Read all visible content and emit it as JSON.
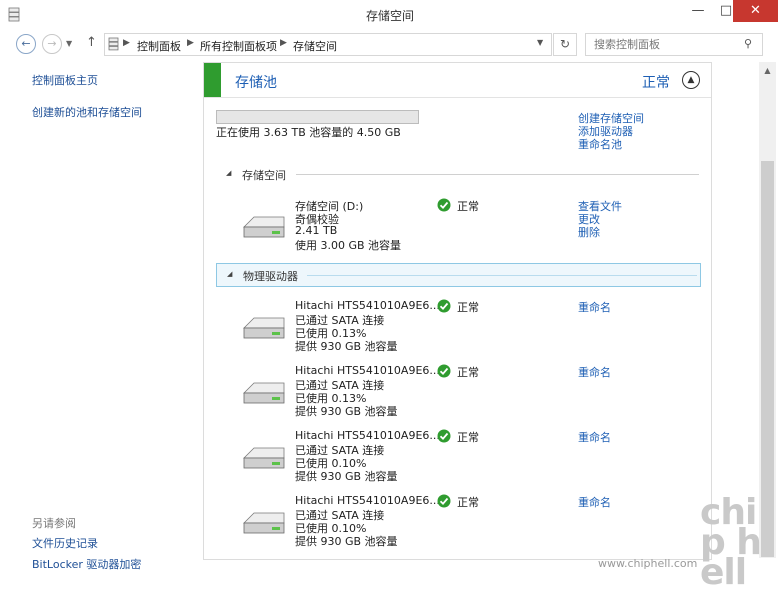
{
  "window": {
    "title": "存储空间",
    "min_label": "—",
    "max_label": "□",
    "close_label": "✕"
  },
  "address": {
    "crumbs": [
      "控制面板",
      "所有控制面板项",
      "存储空间"
    ],
    "search_placeholder": "搜索控制面板"
  },
  "sidebar": {
    "links": [
      "控制面板主页",
      "创建新的池和存储空间"
    ],
    "see_also_label": "另请参阅",
    "see_also": [
      "文件历史记录",
      "BitLocker 驱动器加密"
    ]
  },
  "pool": {
    "title": "存储池",
    "status": "正常",
    "usage_text": "正在使用 3.63 TB 池容量的 4.50 GB",
    "usage_fraction": 0.001,
    "actions": [
      "创建存储空间",
      "添加驱动器",
      "重命名池"
    ]
  },
  "spaces_section": {
    "title": "存储空间",
    "items": [
      {
        "lines": [
          "存储空间 (D:)",
          "奇偶校验",
          "2.41 TB",
          "使用 3.00 GB 池容量"
        ],
        "status": "正常",
        "actions": [
          "查看文件",
          "更改",
          "删除"
        ]
      }
    ]
  },
  "drives_section": {
    "title": "物理驱动器",
    "items": [
      {
        "lines": [
          "Hitachi HTS541010A9E6...",
          "已通过 SATA 连接",
          "已使用 0.13%",
          "提供 930 GB 池容量"
        ],
        "status": "正常",
        "action": "重命名"
      },
      {
        "lines": [
          "Hitachi HTS541010A9E6...",
          "已通过 SATA 连接",
          "已使用 0.13%",
          "提供 930 GB 池容量"
        ],
        "status": "正常",
        "action": "重命名"
      },
      {
        "lines": [
          "Hitachi HTS541010A9E6...",
          "已通过 SATA 连接",
          "已使用 0.10%",
          "提供 930 GB 池容量"
        ],
        "status": "正常",
        "action": "重命名"
      },
      {
        "lines": [
          "Hitachi HTS541010A9E6...",
          "已通过 SATA 连接",
          "已使用 0.10%",
          "提供 930 GB 池容量"
        ],
        "status": "正常",
        "action": "重命名"
      }
    ]
  },
  "watermark": {
    "logo": "chip hell",
    "url": "www.chiphell.com"
  },
  "colors": {
    "accent_green": "#2f9c2f",
    "link_blue": "#1e5fb4",
    "close_red": "#c7372f"
  }
}
